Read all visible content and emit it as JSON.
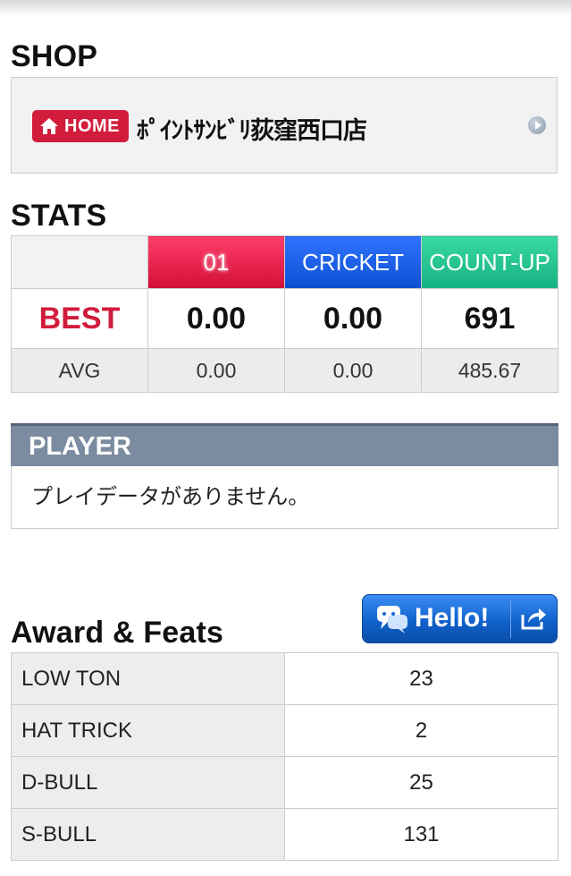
{
  "shop": {
    "title": "SHOP",
    "badge_label": "HOME",
    "name": "ﾎﾟｲﾝﾄｻﾝﾋﾞﾘ荻窪西口店"
  },
  "stats": {
    "title": "STATS",
    "columns": [
      "01",
      "CRICKET",
      "COUNT-UP"
    ],
    "best_label": "BEST",
    "best": [
      "0.00",
      "0.00",
      "691"
    ],
    "avg_label": "AVG",
    "avg": [
      "0.00",
      "0.00",
      "485.67"
    ]
  },
  "player": {
    "title": "PLAYER",
    "message": "プレイデータがありません。"
  },
  "hello_button": {
    "label": "Hello!"
  },
  "awards": {
    "title": "Award & Feats",
    "rows": [
      {
        "name": "LOW TON",
        "value": "23"
      },
      {
        "name": "HAT TRICK",
        "value": "2"
      },
      {
        "name": "D-BULL",
        "value": "25"
      },
      {
        "name": "S-BULL",
        "value": "131"
      }
    ]
  },
  "colors": {
    "accent_red": "#d21c3c",
    "col_01": "#e01744",
    "col_cricket": "#1a5fe8",
    "col_countup": "#22c490",
    "player_header": "#7b8ba0",
    "hello_button": "#1669d8"
  }
}
